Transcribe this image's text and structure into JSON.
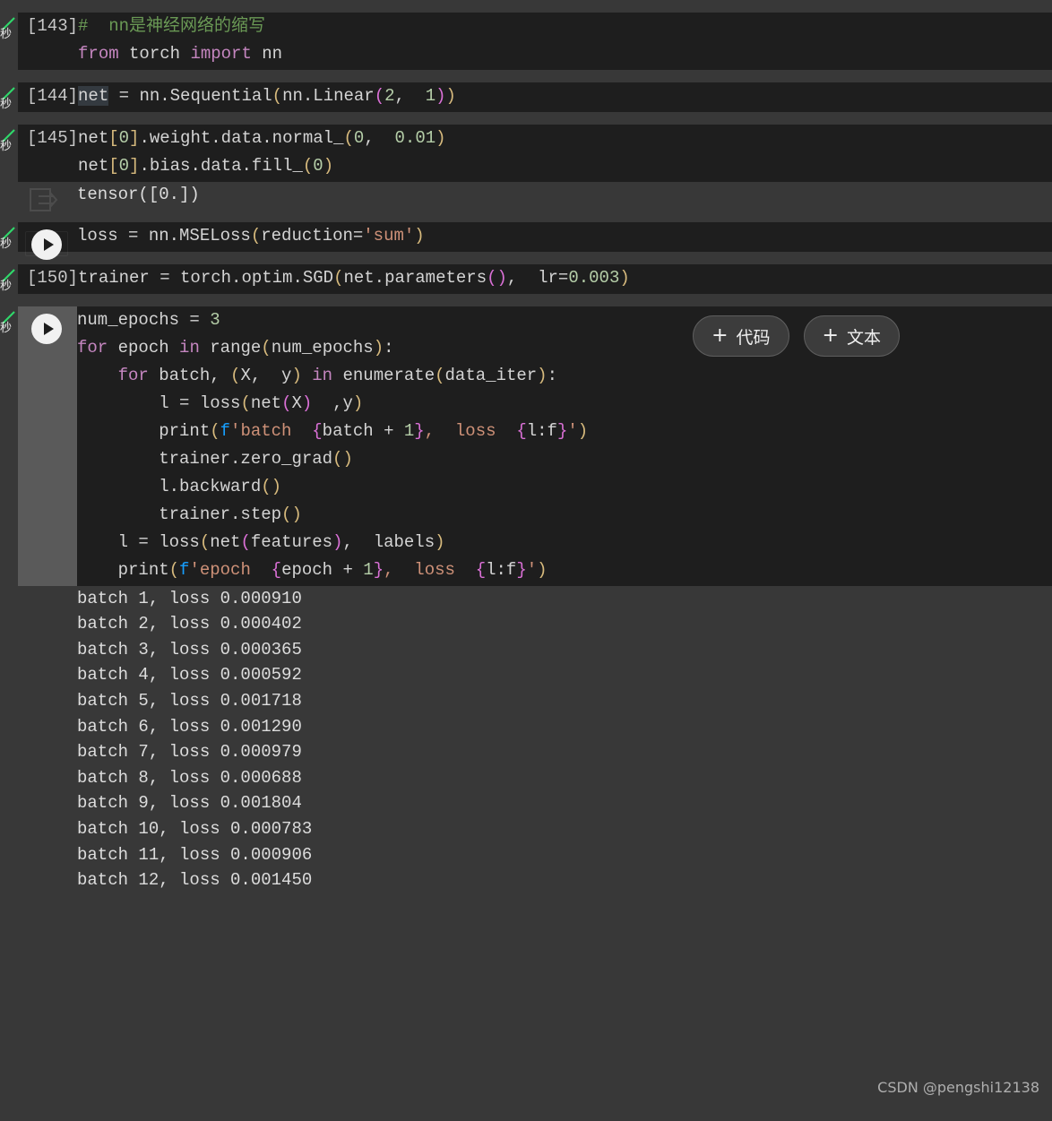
{
  "app": {
    "kind": "jupyter-colab-notebook",
    "page_background": "#383838",
    "cell_background": "#1e1e1e",
    "output_background": "#383838",
    "accent_run_button": "#f1f1f1",
    "status_check_color": "#2fd86a"
  },
  "status_gutter": {
    "check_icon": "green-check-icon",
    "seconds_label": "秒"
  },
  "cells": [
    {
      "exec_count": "[143]",
      "has_run_button": false,
      "lines": [
        [
          {
            "t": "#  nn是神经网络的缩写",
            "c": "c-com"
          }
        ],
        [
          {
            "t": "from",
            "c": "c-kw"
          },
          {
            "t": " torch ",
            "c": "c-id"
          },
          {
            "t": "import",
            "c": "c-kw"
          },
          {
            "t": " nn",
            "c": "c-id"
          }
        ]
      ]
    },
    {
      "exec_count": "[144]",
      "has_run_button": false,
      "lines": [
        [
          {
            "t": "net",
            "c": "c-id c-hl"
          },
          {
            "t": " = nn.Sequential",
            "c": "c-id"
          },
          {
            "t": "(",
            "c": "c-par"
          },
          {
            "t": "nn.Linear",
            "c": "c-id"
          },
          {
            "t": "(",
            "c": "c-par2"
          },
          {
            "t": "2",
            "c": "c-num"
          },
          {
            "t": ",  ",
            "c": "c-id"
          },
          {
            "t": "1",
            "c": "c-num"
          },
          {
            "t": ")",
            "c": "c-par2"
          },
          {
            "t": ")",
            "c": "c-par"
          }
        ]
      ]
    },
    {
      "exec_count": "[145]",
      "has_run_button": false,
      "lines": [
        [
          {
            "t": "net",
            "c": "c-id"
          },
          {
            "t": "[",
            "c": "c-par"
          },
          {
            "t": "0",
            "c": "c-num"
          },
          {
            "t": "]",
            "c": "c-par"
          },
          {
            "t": ".weight.data.normal_",
            "c": "c-id"
          },
          {
            "t": "(",
            "c": "c-par"
          },
          {
            "t": "0",
            "c": "c-num"
          },
          {
            "t": ",  ",
            "c": "c-id"
          },
          {
            "t": "0.01",
            "c": "c-num"
          },
          {
            "t": ")",
            "c": "c-par"
          }
        ],
        [
          {
            "t": "net",
            "c": "c-id"
          },
          {
            "t": "[",
            "c": "c-par"
          },
          {
            "t": "0",
            "c": "c-num"
          },
          {
            "t": "]",
            "c": "c-par"
          },
          {
            "t": ".bias.data.fill_",
            "c": "c-id"
          },
          {
            "t": "(",
            "c": "c-par"
          },
          {
            "t": "0",
            "c": "c-num"
          },
          {
            "t": ")",
            "c": "c-par"
          }
        ]
      ],
      "output": {
        "icon": "output-arrow-icon",
        "lines": [
          "tensor([0.])"
        ]
      }
    },
    {
      "exec_count": "",
      "has_run_button": true,
      "run_button_icon": "play-icon",
      "lines": [
        [
          {
            "t": "loss = nn.MSELoss",
            "c": "c-id"
          },
          {
            "t": "(",
            "c": "c-par"
          },
          {
            "t": "reduction=",
            "c": "c-id"
          },
          {
            "t": "'sum'",
            "c": "c-str"
          },
          {
            "t": ")",
            "c": "c-par"
          }
        ]
      ]
    },
    {
      "exec_count": "[150]",
      "has_run_button": false,
      "lines": [
        [
          {
            "t": "trainer = torch.optim.SGD",
            "c": "c-id"
          },
          {
            "t": "(",
            "c": "c-par"
          },
          {
            "t": "net.parameters",
            "c": "c-id"
          },
          {
            "t": "(",
            "c": "c-par2"
          },
          {
            "t": ")",
            "c": "c-par2"
          },
          {
            "t": ",  lr=",
            "c": "c-id"
          },
          {
            "t": "0.003",
            "c": "c-num"
          },
          {
            "t": ")",
            "c": "c-par"
          }
        ]
      ]
    },
    {
      "exec_count": "",
      "has_run_button": true,
      "run_button_icon": "play-icon",
      "wide_gutter": true,
      "lines": [
        [
          {
            "t": "num_epochs = ",
            "c": "c-id"
          },
          {
            "t": "3",
            "c": "c-num"
          }
        ],
        [
          {
            "t": "for",
            "c": "c-kw"
          },
          {
            "t": " epoch ",
            "c": "c-id"
          },
          {
            "t": "in",
            "c": "c-kw"
          },
          {
            "t": " range",
            "c": "c-id"
          },
          {
            "t": "(",
            "c": "c-par"
          },
          {
            "t": "num_epochs",
            "c": "c-id"
          },
          {
            "t": ")",
            "c": "c-par"
          },
          {
            "t": ":",
            "c": "c-id"
          }
        ],
        [
          {
            "t": "    ",
            "c": "c-id"
          },
          {
            "t": "for",
            "c": "c-kw"
          },
          {
            "t": " batch, ",
            "c": "c-id"
          },
          {
            "t": "(",
            "c": "c-par"
          },
          {
            "t": "X,  y",
            "c": "c-id"
          },
          {
            "t": ")",
            "c": "c-par"
          },
          {
            "t": " ",
            "c": "c-id"
          },
          {
            "t": "in",
            "c": "c-kw"
          },
          {
            "t": " enumerate",
            "c": "c-id"
          },
          {
            "t": "(",
            "c": "c-par"
          },
          {
            "t": "data_iter",
            "c": "c-id"
          },
          {
            "t": ")",
            "c": "c-par"
          },
          {
            "t": ":",
            "c": "c-id"
          }
        ],
        [
          {
            "t": "        l = loss",
            "c": "c-id"
          },
          {
            "t": "(",
            "c": "c-par"
          },
          {
            "t": "net",
            "c": "c-id"
          },
          {
            "t": "(",
            "c": "c-par2"
          },
          {
            "t": "X",
            "c": "c-id"
          },
          {
            "t": ")",
            "c": "c-par2"
          },
          {
            "t": "  ,y",
            "c": "c-id"
          },
          {
            "t": ")",
            "c": "c-par"
          }
        ],
        [
          {
            "t": "        print",
            "c": "c-id"
          },
          {
            "t": "(",
            "c": "c-par"
          },
          {
            "t": "f",
            "c": "c-par3"
          },
          {
            "t": "'batch  ",
            "c": "c-str"
          },
          {
            "t": "{",
            "c": "c-par2"
          },
          {
            "t": "batch + ",
            "c": "c-id"
          },
          {
            "t": "1",
            "c": "c-num"
          },
          {
            "t": "}",
            "c": "c-par2"
          },
          {
            "t": ",  loss  ",
            "c": "c-str"
          },
          {
            "t": "{",
            "c": "c-par2"
          },
          {
            "t": "l:f",
            "c": "c-id"
          },
          {
            "t": "}",
            "c": "c-par2"
          },
          {
            "t": "'",
            "c": "c-str"
          },
          {
            "t": ")",
            "c": "c-par"
          }
        ],
        [
          {
            "t": "        trainer.zero_grad",
            "c": "c-id"
          },
          {
            "t": "(",
            "c": "c-par"
          },
          {
            "t": ")",
            "c": "c-par"
          }
        ],
        [
          {
            "t": "        l.backward",
            "c": "c-id"
          },
          {
            "t": "(",
            "c": "c-par"
          },
          {
            "t": ")",
            "c": "c-par"
          }
        ],
        [
          {
            "t": "        trainer.step",
            "c": "c-id"
          },
          {
            "t": "(",
            "c": "c-par"
          },
          {
            "t": ")",
            "c": "c-par"
          }
        ],
        [
          {
            "t": "    l = loss",
            "c": "c-id"
          },
          {
            "t": "(",
            "c": "c-par"
          },
          {
            "t": "net",
            "c": "c-id"
          },
          {
            "t": "(",
            "c": "c-par2"
          },
          {
            "t": "features",
            "c": "c-id"
          },
          {
            "t": ")",
            "c": "c-par2"
          },
          {
            "t": ",  labels",
            "c": "c-id"
          },
          {
            "t": ")",
            "c": "c-par"
          }
        ],
        [
          {
            "t": "    print",
            "c": "c-id"
          },
          {
            "t": "(",
            "c": "c-par"
          },
          {
            "t": "f",
            "c": "c-par3"
          },
          {
            "t": "'epoch  ",
            "c": "c-str"
          },
          {
            "t": "{",
            "c": "c-par2"
          },
          {
            "t": "epoch + ",
            "c": "c-id"
          },
          {
            "t": "1",
            "c": "c-num"
          },
          {
            "t": "}",
            "c": "c-par2"
          },
          {
            "t": ",  loss  ",
            "c": "c-str"
          },
          {
            "t": "{",
            "c": "c-par2"
          },
          {
            "t": "l:f",
            "c": "c-id"
          },
          {
            "t": "}",
            "c": "c-par2"
          },
          {
            "t": "'",
            "c": "c-str"
          },
          {
            "t": ")",
            "c": "c-par"
          }
        ]
      ],
      "output": {
        "icon": null,
        "lines": [
          "batch 1, loss 0.000910",
          "batch 2, loss 0.000402",
          "batch 3, loss 0.000365",
          "batch 4, loss 0.000592",
          "batch 5, loss 0.001718",
          "batch 6, loss 0.001290",
          "batch 7, loss 0.000979",
          "batch 8, loss 0.000688",
          "batch 9, loss 0.001804",
          "batch 10, loss 0.000783",
          "batch 11, loss 0.000906",
          "batch 12, loss 0.001450"
        ]
      }
    }
  ],
  "add_buttons": [
    {
      "icon": "plus-icon",
      "label": "代码",
      "name": "add-code-button"
    },
    {
      "icon": "plus-icon",
      "label": "文本",
      "name": "add-text-button"
    }
  ],
  "watermark": "CSDN @pengshi12138"
}
